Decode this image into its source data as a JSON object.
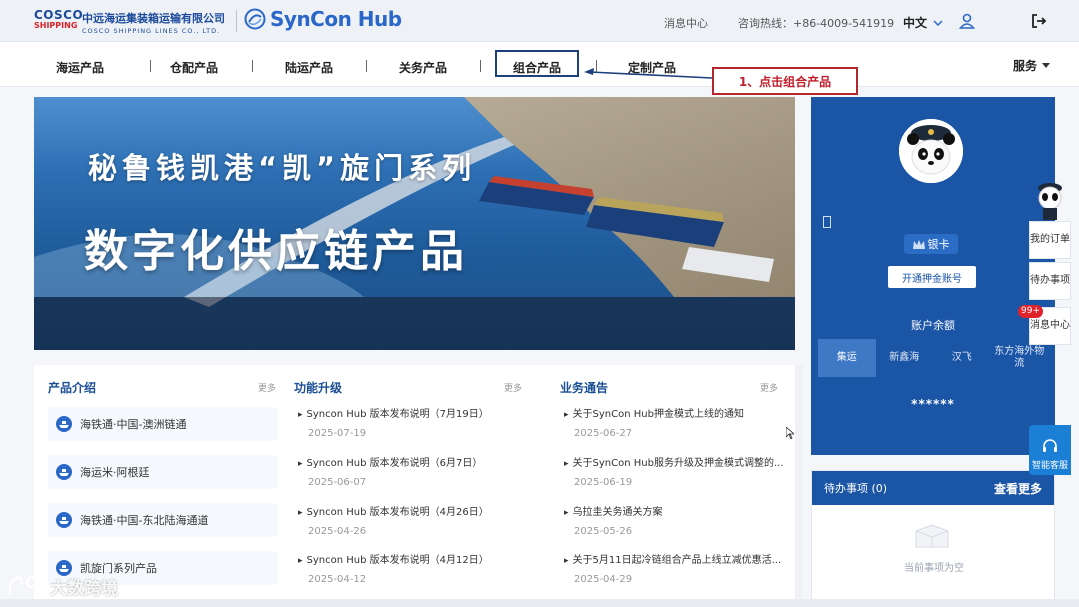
{
  "header": {
    "brand_cosco_top": "COSCO",
    "brand_cosco_bottom": "SHIPPING",
    "company_cn": "中远海运集装箱运输有限公司",
    "company_en": "COSCO SHIPPING LINES CO., LTD.",
    "product_logo": "SynCon Hub",
    "message_center": "消息中心",
    "hotline": "咨询热线：+86-4009-541919",
    "language": "中文",
    "user_icon": "user-icon",
    "logout_icon": "logout-icon"
  },
  "nav": {
    "items": [
      "海运产品",
      "仓配产品",
      "陆运产品",
      "关务产品",
      "组合产品",
      "定制产品"
    ],
    "service": "服务",
    "active_index": 4
  },
  "annotation": {
    "label": "1、点击组合产品",
    "color": "#b3272c"
  },
  "banner": {
    "title_line1": "秘鲁钱凯港“凯”旋门系列",
    "title_line2": "数字化供应链产品"
  },
  "profile": {
    "card_type": "银卡",
    "open_button": "开通押金账号",
    "balance_label": "账户余额",
    "tabs": [
      "集运",
      "新鑫海",
      "汉飞",
      "东方海外物流"
    ],
    "active_tab": 0,
    "balance_value": "******"
  },
  "todo": {
    "title": "待办事项 (0)",
    "more": "查看更多",
    "empty": "当前事项为空"
  },
  "side": {
    "items": [
      "我的订单",
      "待办事项",
      "消息中心"
    ],
    "badge": "99+",
    "ai": "智能客服"
  },
  "columns": {
    "product_intro": {
      "title": "产品介绍",
      "more": "更多",
      "items": [
        "海铁通·中国-澳洲链通",
        "海运米·阿根廷",
        "海铁通·中国-东北陆海通道",
        "凯旋门系列产品"
      ]
    },
    "upgrades": {
      "title": "功能升级",
      "more": "更多",
      "items": [
        {
          "title": "Syncon Hub 版本发布说明（7月19日）",
          "date": "2025-07-19"
        },
        {
          "title": "Syncon Hub 版本发布说明（6月7日）",
          "date": "2025-06-07"
        },
        {
          "title": "Syncon Hub 版本发布说明（4月26日）",
          "date": "2025-04-26"
        },
        {
          "title": "Syncon Hub 版本发布说明（4月12日）",
          "date": "2025-04-12"
        }
      ]
    },
    "notices": {
      "title": "业务通告",
      "more": "更多",
      "items": [
        {
          "title": "关于SynCon Hub押金模式上线的通知",
          "date": "2025-06-27"
        },
        {
          "title": "关于SynCon Hub服务升级及押金模式调整的...",
          "date": "2025-06-19"
        },
        {
          "title": "乌拉圭关务通关方案",
          "date": "2025-05-26"
        },
        {
          "title": "关于5月11日起冷链组合产品上线立减优惠活...",
          "date": "2025-04-29"
        }
      ]
    }
  },
  "watermark": "大数跨境"
}
